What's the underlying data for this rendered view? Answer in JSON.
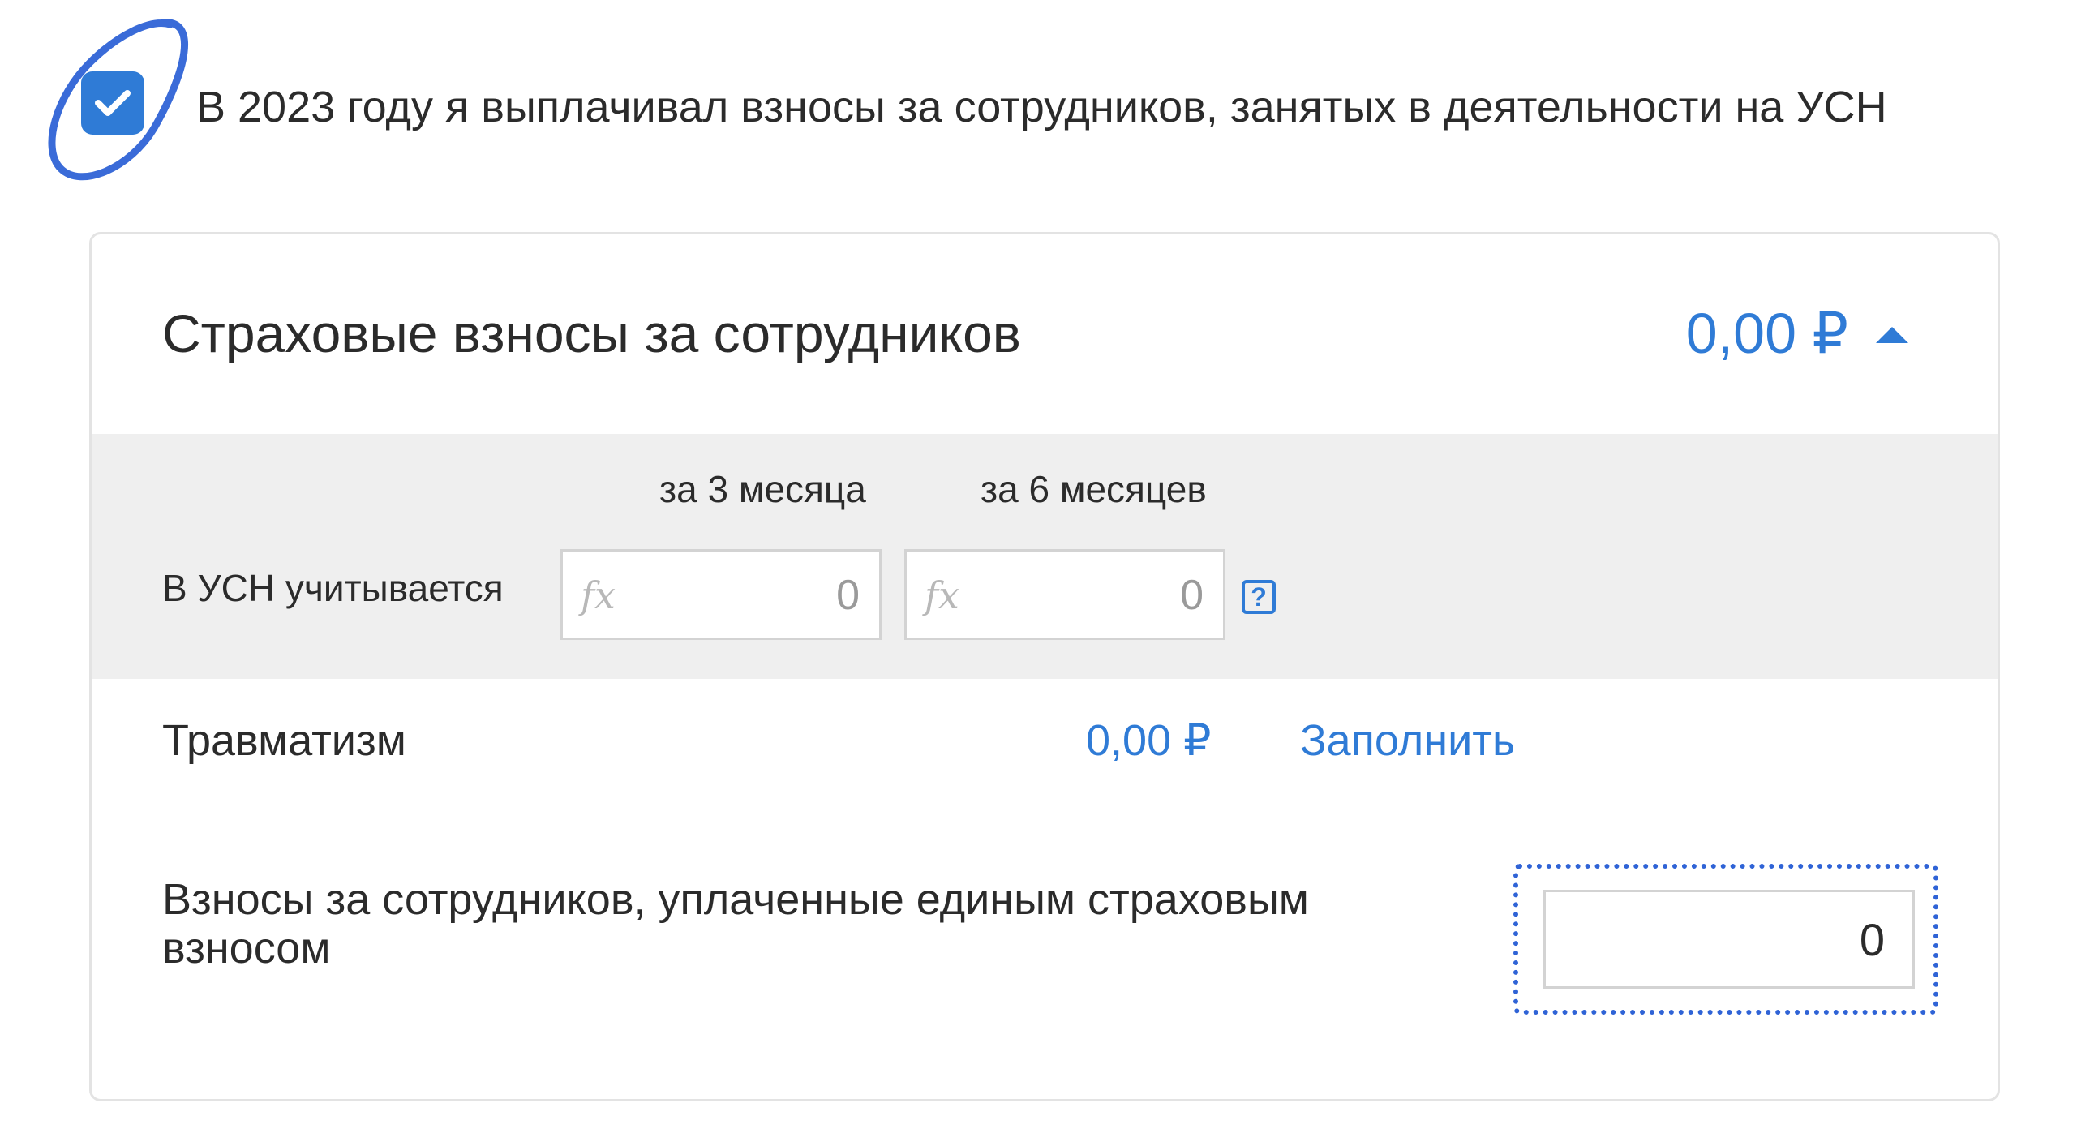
{
  "checkbox": {
    "checked": true,
    "label": "В 2023 году я выплачивал взносы за сотрудников, занятых в деятельности на УСН"
  },
  "card": {
    "title": "Страховые взносы за сотрудников",
    "total": "0,00 ₽",
    "toggle_icon": "caret-up-icon",
    "table": {
      "columns": [
        "за 3 месяца",
        "за 6 месяцев"
      ],
      "row_label": "В УСН учитывается",
      "formula_icon": "fx",
      "values": [
        "0",
        "0"
      ],
      "help_label": "?"
    },
    "trauma": {
      "label": "Травматизм",
      "value": "0,00 ₽",
      "action": "Заполнить"
    },
    "single_contribution": {
      "label": "Взносы за сотрудников, уплаченные единым страховым взносом",
      "value": "0"
    }
  },
  "colors": {
    "accent": "#2f7bd6",
    "focus_outline": "#2f63d6",
    "section_bg": "#efefef"
  }
}
